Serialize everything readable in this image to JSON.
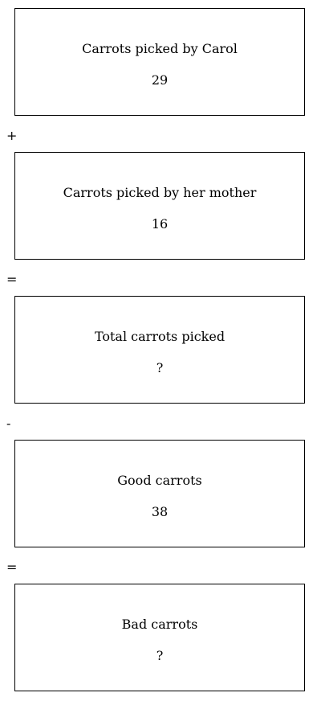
{
  "steps": [
    {
      "label": "Carrots picked by Carol",
      "value": "29"
    },
    {
      "label": "Carrots picked by her mother",
      "value": "16"
    },
    {
      "label": "Total carrots picked",
      "value": "?"
    },
    {
      "label": "Good carrots",
      "value": "38"
    },
    {
      "label": "Bad carrots",
      "value": "?"
    }
  ],
  "operators": [
    "+",
    "=",
    "-",
    "="
  ]
}
